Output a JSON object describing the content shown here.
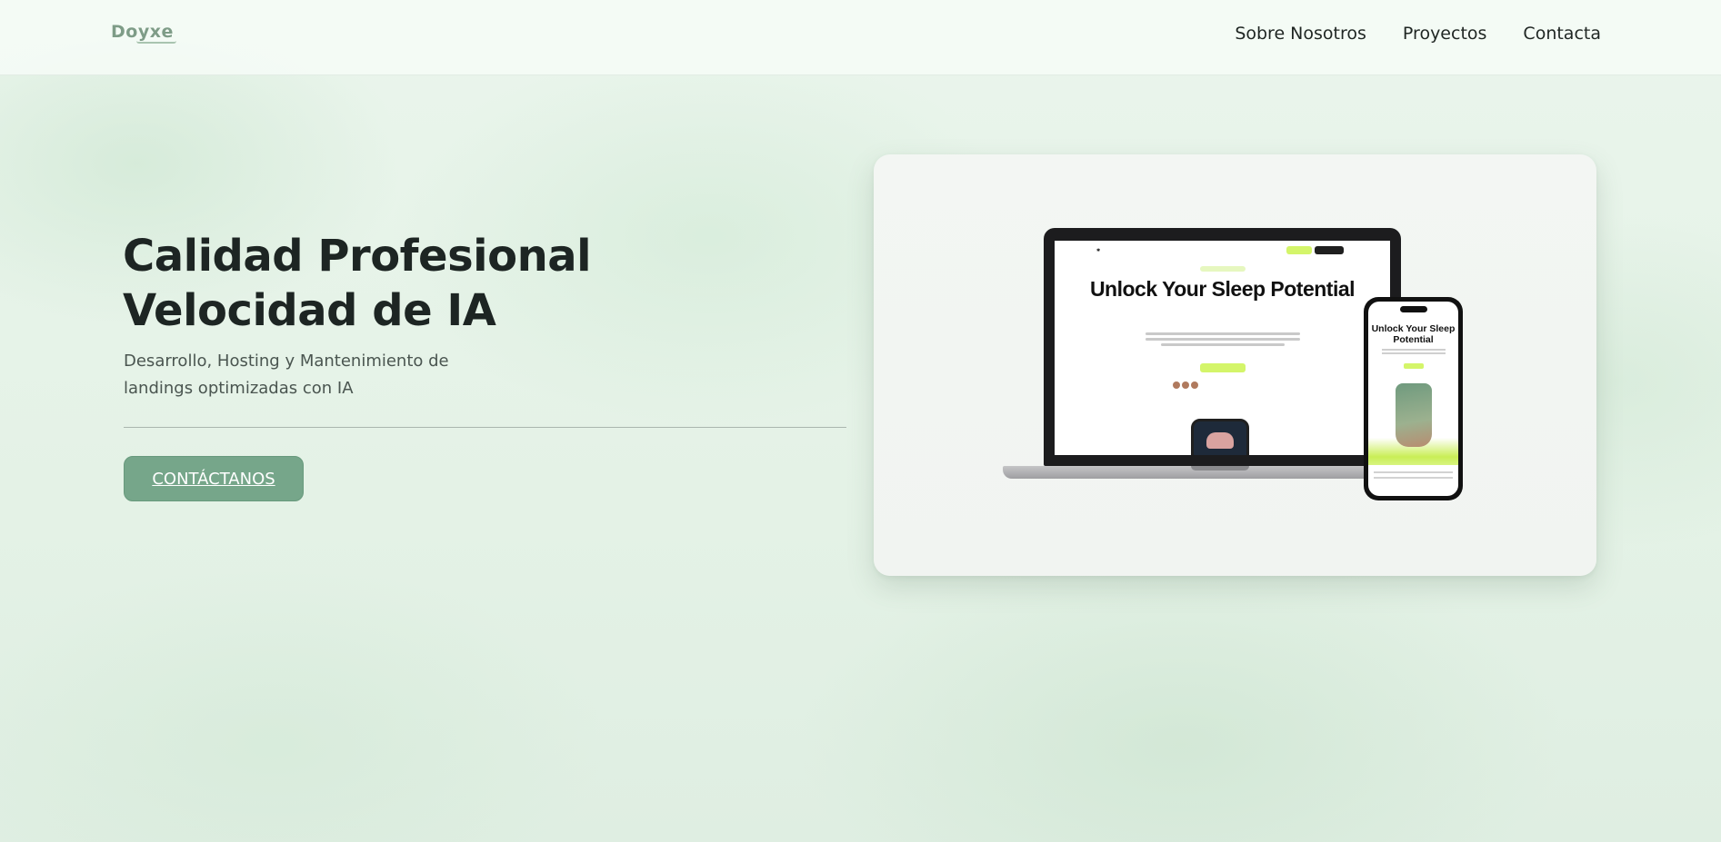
{
  "header": {
    "logo": "Doyxe",
    "nav": [
      "Sobre Nosotros",
      "Proyectos",
      "Contacta"
    ]
  },
  "hero": {
    "title_line1": "Calidad Profesional",
    "title_line2": "Velocidad de IA",
    "subtitle": "Desarrollo, Hosting y Mantenimiento de landings optimizadas con IA",
    "cta_label": "CONTÁCTANOS"
  },
  "mockup": {
    "headline": "Unlock Your Sleep Potential",
    "colors": {
      "accent": "#d4f56a",
      "button": "#76a68a",
      "text": "#1d2523"
    }
  }
}
